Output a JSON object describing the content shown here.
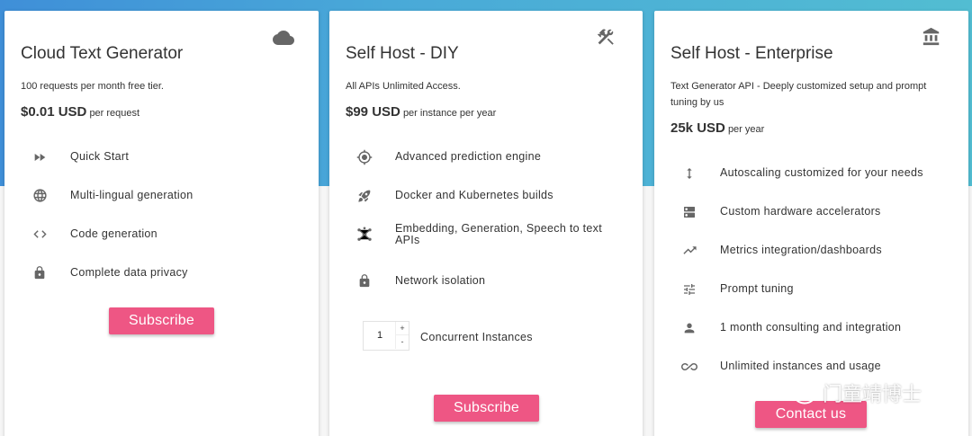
{
  "plans": [
    {
      "title": "Cloud Text Generator",
      "corner_icon": "cloud-icon",
      "description": "100 requests per month free tier.",
      "price_value": "$0.01 USD",
      "price_unit": "per request",
      "features": [
        {
          "icon": "fast-forward-icon",
          "label": "Quick Start"
        },
        {
          "icon": "globe-icon",
          "label": "Multi-lingual generation"
        },
        {
          "icon": "code-icon",
          "label": "Code generation"
        },
        {
          "icon": "lock-icon",
          "label": "Complete data privacy"
        }
      ],
      "button_label": "Subscribe"
    },
    {
      "title": "Self Host - DIY",
      "corner_icon": "tools-icon",
      "description": "All APIs Unlimited Access.",
      "price_value": "$99 USD",
      "price_unit": "per instance per year",
      "features": [
        {
          "icon": "crosshair-icon",
          "label": "Advanced prediction engine"
        },
        {
          "icon": "rocket-icon",
          "label": "Docker and Kubernetes builds"
        },
        {
          "icon": "hub-icon",
          "label": "Embedding, Generation, Speech to text APIs"
        },
        {
          "icon": "lock-icon",
          "label": "Network isolation"
        }
      ],
      "stepper": {
        "value": "1",
        "up": "+",
        "down": "-",
        "label": "Concurrent Instances"
      },
      "button_label": "Subscribe"
    },
    {
      "title": "Self Host - Enterprise",
      "corner_icon": "bank-icon",
      "description": "Text Generator API - Deeply customized setup and prompt tuning by us",
      "price_value": "25k USD",
      "price_unit": "per year",
      "features": [
        {
          "icon": "vertical-arrows-icon",
          "label": "Autoscaling customized for your needs"
        },
        {
          "icon": "server-icon",
          "label": "Custom hardware accelerators"
        },
        {
          "icon": "trending-up-icon",
          "label": "Metrics integration/dashboards"
        },
        {
          "icon": "tune-icon",
          "label": "Prompt tuning"
        },
        {
          "icon": "person-icon",
          "label": "1 month consulting and integration"
        },
        {
          "icon": "infinity-icon",
          "label": "Unlimited instances and usage"
        }
      ],
      "button_label": "Contact us"
    }
  ],
  "watermark": {
    "text": "门童靖博士",
    "icon": "wechat-logo-icon"
  },
  "colors": {
    "hero_gradient_start": "#3f8fd8",
    "hero_gradient_end": "#52bdd2",
    "button": "#ee5684",
    "icon": "#666666"
  }
}
